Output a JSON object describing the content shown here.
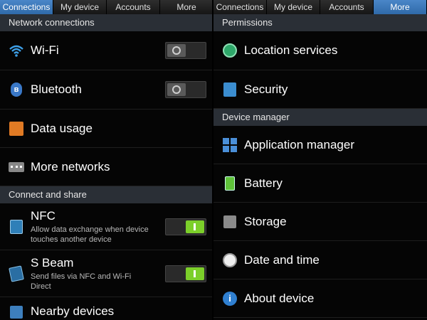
{
  "left_tabs": [
    "Connections",
    "My device",
    "Accounts",
    "More"
  ],
  "right_tabs": [
    "Connections",
    "My device",
    "Accounts",
    "More"
  ],
  "left": {
    "section1": "Network connections",
    "wifi": "Wi-Fi",
    "wifi_state": "off",
    "bluetooth": "Bluetooth",
    "bluetooth_icon": "ʙ",
    "bluetooth_state": "off",
    "data_usage": "Data usage",
    "more_networks": "More networks",
    "section2": "Connect and share",
    "nfc": "NFC",
    "nfc_desc": "Allow data exchange when device touches another device",
    "nfc_state": "on",
    "sbeam": "S Beam",
    "sbeam_desc": "Send files via NFC and Wi-Fi Direct",
    "sbeam_state": "on",
    "nearby": "Nearby devices"
  },
  "right": {
    "section1": "Permissions",
    "location": "Location services",
    "security": "Security",
    "section2": "Device manager",
    "app_manager": "Application manager",
    "battery": "Battery",
    "storage": "Storage",
    "date_time": "Date and time",
    "about": "About device",
    "about_icon": "i"
  },
  "colors": {
    "active_tab": "#3d7dc2",
    "section_bg": "#2a2f36",
    "toggle_on": "#7ccf2a"
  }
}
